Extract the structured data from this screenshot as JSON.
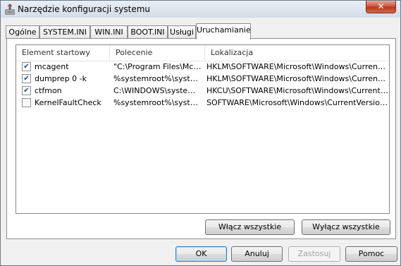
{
  "window": {
    "title": "Narzędzie konfiguracji systemu",
    "close_glyph": "✕"
  },
  "tabs": [
    {
      "label": "Ogólne"
    },
    {
      "label": "SYSTEM.INI"
    },
    {
      "label": "WIN.INI"
    },
    {
      "label": "BOOT.INI"
    },
    {
      "label": "Usługi"
    },
    {
      "label": "Uruchamianie"
    }
  ],
  "active_tab": "Uruchamianie",
  "list": {
    "columns": [
      "Element startowy",
      "Polecenie",
      "Lokalizacja"
    ],
    "rows": [
      {
        "checked": true,
        "name": "mcagent",
        "command": "\"C:\\Program Files\\McA...",
        "location": "HKLM\\SOFTWARE\\Microsoft\\Windows\\CurrentVer..."
      },
      {
        "checked": true,
        "name": "dumprep 0 -k",
        "command": "%systemroot%\\syste...",
        "location": "HKLM\\SOFTWARE\\Microsoft\\Windows\\CurrentVer..."
      },
      {
        "checked": true,
        "name": "ctfmon",
        "command": "C:\\WINDOWS\\system...",
        "location": "HKCU\\SOFTWARE\\Microsoft\\Windows\\CurrentVer..."
      },
      {
        "checked": false,
        "name": "KernelFaultCheck",
        "command": "%systemroot%\\syste...",
        "location": "SOFTWARE\\Microsoft\\Windows\\CurrentVersion\\Run"
      }
    ]
  },
  "panel_buttons": {
    "enable_all": "Włącz wszystkie",
    "disable_all": "Wyłącz wszystkie"
  },
  "dialog_buttons": {
    "ok": "OK",
    "cancel": "Anuluj",
    "apply": "Zastosuj",
    "help": "Pomoc"
  },
  "icons": {
    "app": "msconfig-icon",
    "checkbox_checked": "✔"
  }
}
